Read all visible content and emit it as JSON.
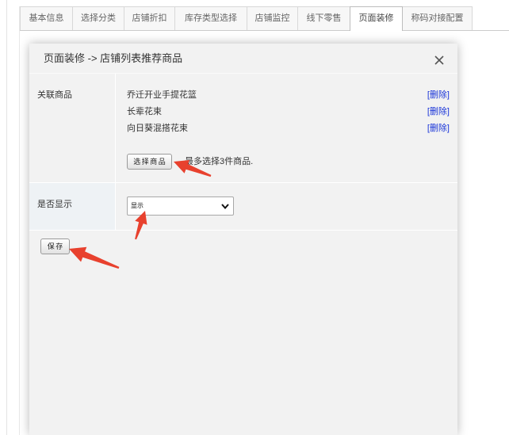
{
  "tabs": {
    "items": [
      {
        "label": "基本信息"
      },
      {
        "label": "选择分类"
      },
      {
        "label": "店铺折扣"
      },
      {
        "label": "库存类型选择"
      },
      {
        "label": "店铺监控"
      },
      {
        "label": "线下零售"
      },
      {
        "label": "页面装修",
        "active": true
      },
      {
        "label": "称码对接配置"
      }
    ]
  },
  "modal": {
    "title": "页面装修 -> 店铺列表推荐商品",
    "close_icon": "close-icon",
    "related_goods": {
      "label": "关联商品",
      "items": [
        {
          "name": "乔迁开业手提花篮",
          "delete_label": "[删除]"
        },
        {
          "name": "长辈花束",
          "delete_label": "[删除]"
        },
        {
          "name": "向日葵混搭花束",
          "delete_label": "[删除]"
        }
      ],
      "select_button_label": "选择商品",
      "hint": "最多选择3件商品."
    },
    "display": {
      "label": "是否显示",
      "selected_value": "显示",
      "dropdown_icon": "chevron-down-icon"
    },
    "save_button_label": "保存"
  },
  "colors": {
    "delete_link": "#1a35d8",
    "annotation_arrow": "#e8412e"
  }
}
